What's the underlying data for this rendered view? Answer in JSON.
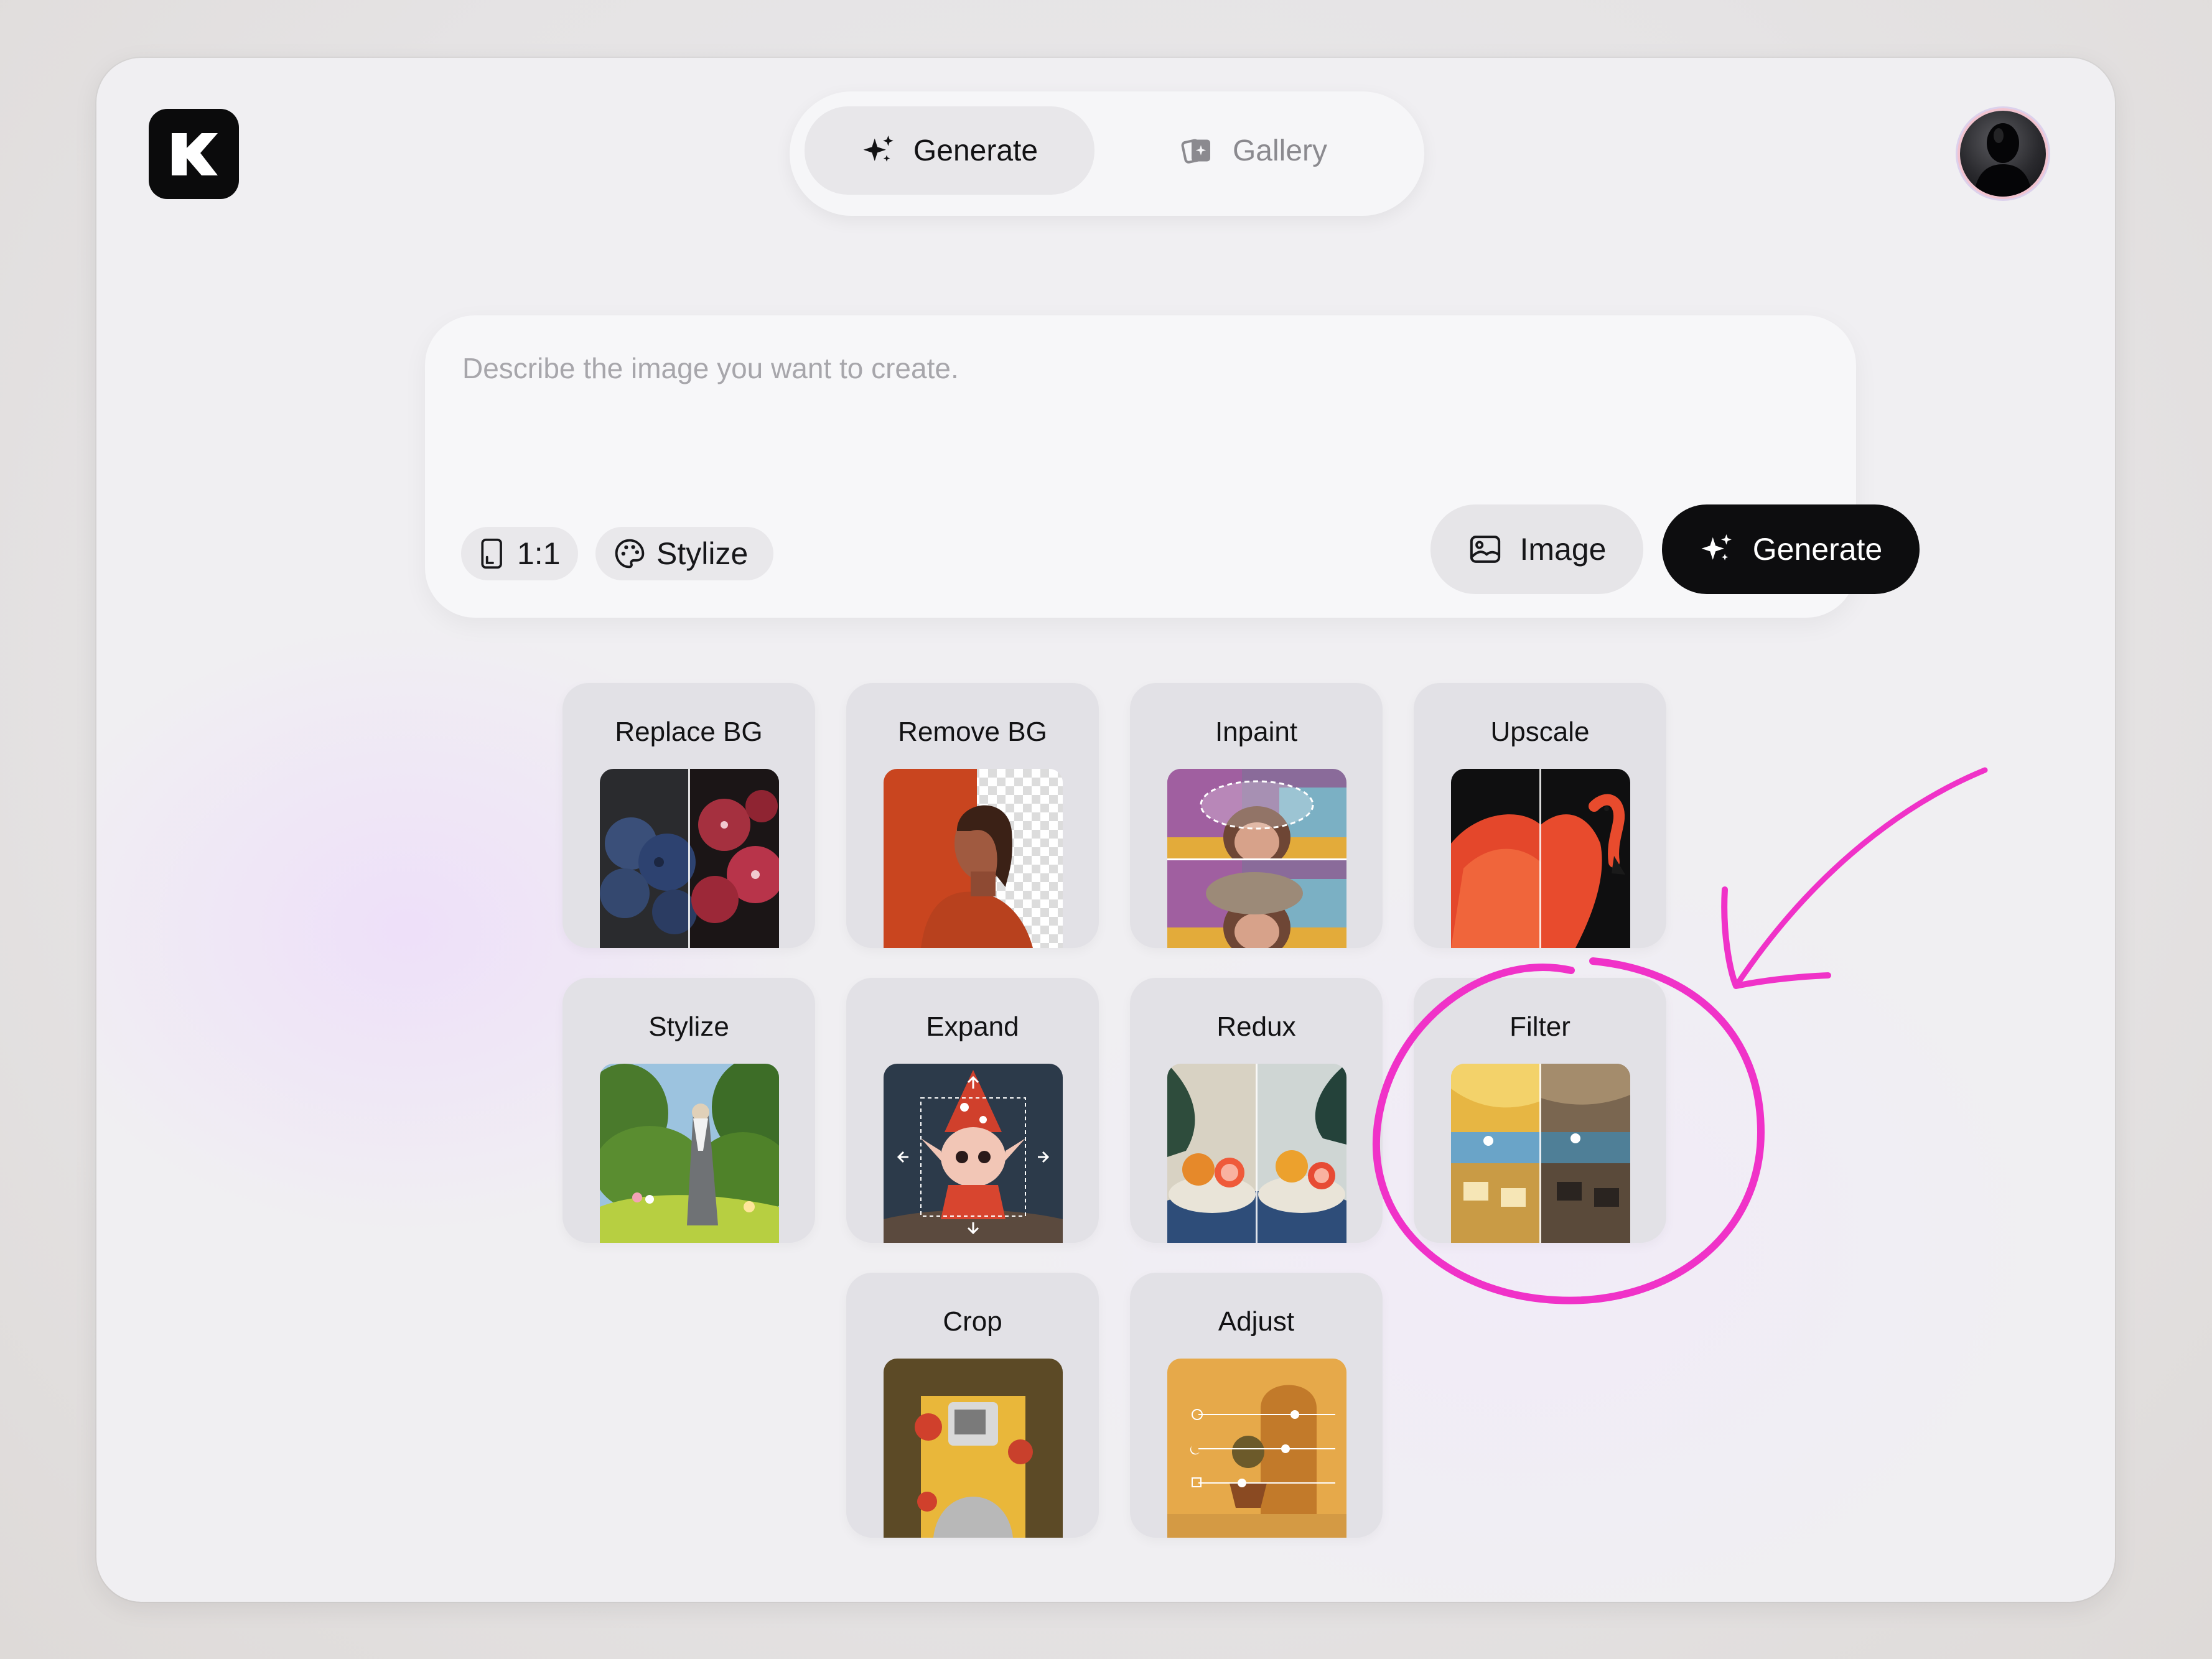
{
  "header": {
    "logo_letter": "K",
    "tabs": [
      {
        "label": "Generate",
        "icon": "sparkle-icon",
        "active": true
      },
      {
        "label": "Gallery",
        "icon": "gallery-icon",
        "active": false
      }
    ]
  },
  "prompt": {
    "placeholder": "Describe the image you want to create.",
    "value": "",
    "aspect_ratio": "1:1",
    "stylize_label": "Stylize",
    "image_button": "Image",
    "generate_button": "Generate"
  },
  "tools": [
    {
      "label": "Replace BG"
    },
    {
      "label": "Remove BG"
    },
    {
      "label": "Inpaint"
    },
    {
      "label": "Upscale"
    },
    {
      "label": "Stylize"
    },
    {
      "label": "Expand"
    },
    {
      "label": "Redux"
    },
    {
      "label": "Filter"
    },
    {
      "label": "Crop"
    },
    {
      "label": "Adjust"
    }
  ],
  "colors": {
    "accent": "#0d0d0f",
    "annotation": "#f032c8",
    "background": "#f0eff2"
  }
}
